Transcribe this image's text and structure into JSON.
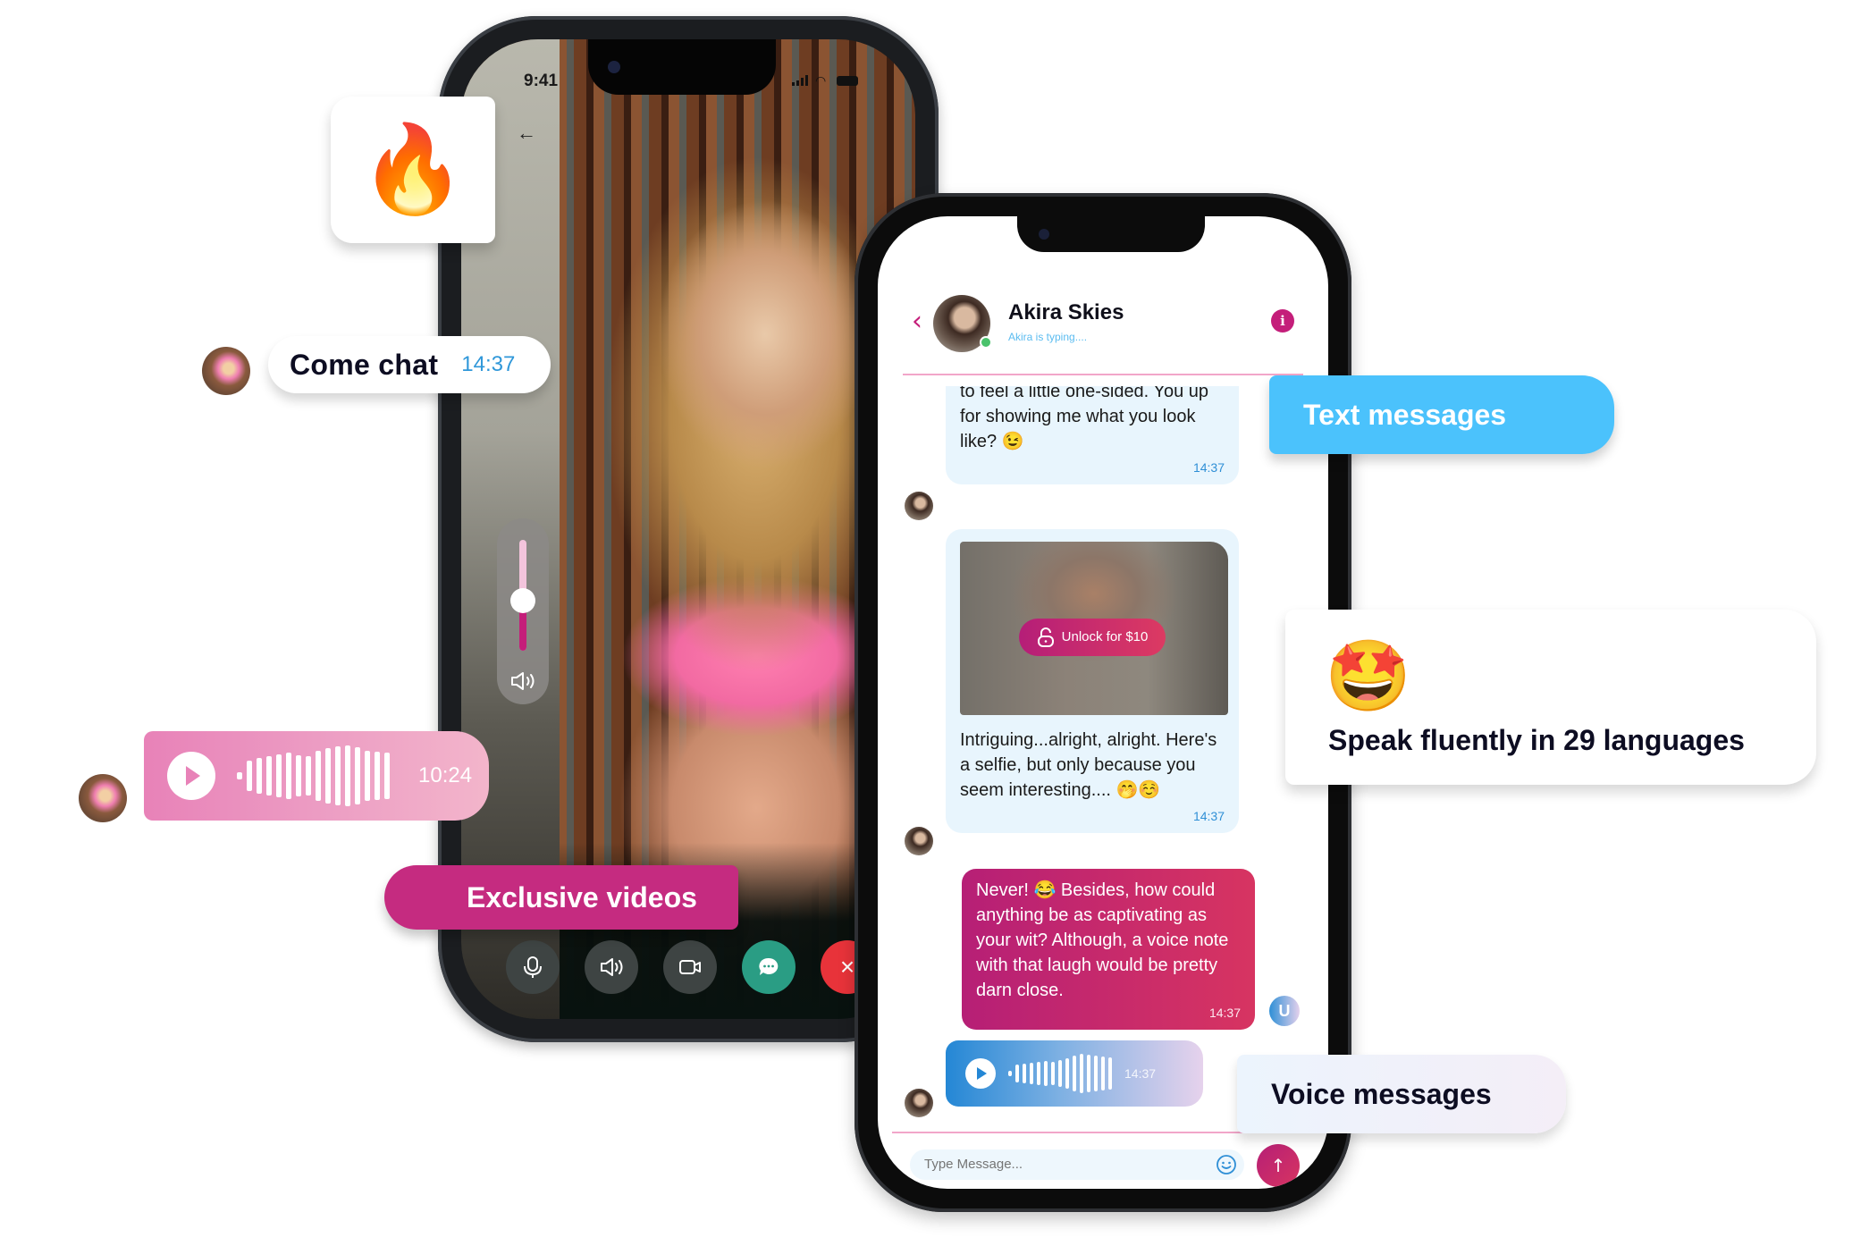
{
  "video_call": {
    "status_time": "9:41",
    "back_icon": "arrow-left-icon",
    "volume_percent": 45,
    "controls": [
      {
        "name": "mic",
        "icon": "microphone-icon"
      },
      {
        "name": "speaker",
        "icon": "speaker-icon"
      },
      {
        "name": "video",
        "icon": "video-camera-icon"
      },
      {
        "name": "chat",
        "icon": "chat-bubble-icon",
        "color": "#2a9d84"
      },
      {
        "name": "end-call",
        "icon": "close-icon",
        "label": "×",
        "color": "#e8333a"
      }
    ]
  },
  "chat": {
    "contact_name": "Akira Skies",
    "contact_status": "Akira is typing....",
    "back_label": "‹",
    "info_label": "i",
    "messages": [
      {
        "direction": "in",
        "text": "to feel a little one-sided.  You up for showing me what you look like? 😉",
        "time": "14:37"
      },
      {
        "direction": "in",
        "type": "locked-image",
        "unlock_label": "Unlock for $10",
        "text": "Intriguing...alright, alright. Here's a selfie, but only because you seem interesting.... 🤭☺️",
        "time": "14:37"
      },
      {
        "direction": "out",
        "text": "Never! 😂 Besides, how could anything be as captivating as your wit? Although, a voice note with that laugh would be pretty darn close.",
        "time": "14:37",
        "avatar_initial": "U"
      },
      {
        "direction": "out",
        "type": "voice",
        "time": "14:37"
      }
    ],
    "input_placeholder": "Type Message...",
    "send_label": "↑"
  },
  "badges": {
    "fire_emoji": "🔥",
    "come_chat": {
      "text": "Come chat",
      "time": "14:37"
    },
    "voice_note": {
      "time": "10:24"
    },
    "exclusive_videos": "Exclusive videos",
    "text_messages": "Text messages",
    "speak": {
      "emoji": "🤩",
      "text": "Speak fluently in 29 languages"
    },
    "voice_messages": "Voice messages"
  },
  "colors": {
    "brand_pink": "#c41e7a",
    "brand_blue": "#4bc2fc",
    "online": "#4ac26b"
  }
}
